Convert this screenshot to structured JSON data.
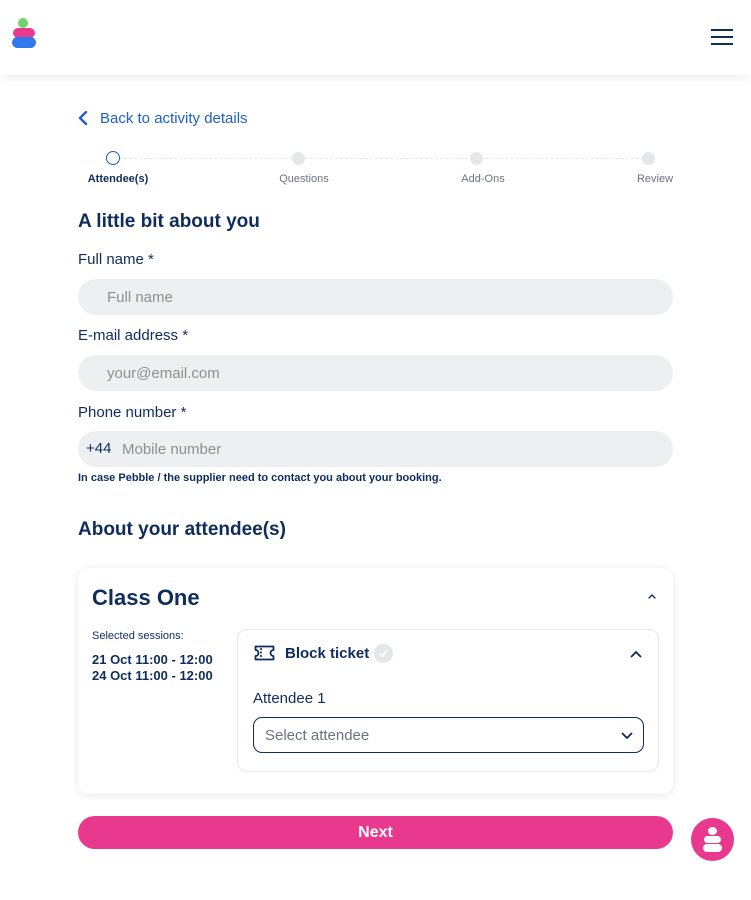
{
  "header": {
    "logo_icon": "pebble-logo",
    "menu_icon": "hamburger-menu-icon",
    "colors": {
      "logo_green": "#6ed36b",
      "logo_pink": "#ea3a8f",
      "logo_blue": "#2f78ef"
    }
  },
  "back_link": {
    "label": "Back to activity details",
    "icon": "chevron-left-icon"
  },
  "stepper": {
    "steps": [
      {
        "label": "Attendee(s)",
        "active": true
      },
      {
        "label": "Questions",
        "active": false
      },
      {
        "label": "Add-Ons",
        "active": false
      },
      {
        "label": "Review",
        "active": false
      }
    ]
  },
  "about_you": {
    "heading": "A little bit about you",
    "full_name": {
      "label": "Full name *",
      "placeholder": "Full name",
      "value": ""
    },
    "email": {
      "label": "E-mail address *",
      "placeholder": "your@email.com",
      "value": ""
    },
    "phone": {
      "label": "Phone number *",
      "country_code": "+44",
      "placeholder": "Mobile number",
      "value": ""
    },
    "hint": "In case Pebble / the supplier need to contact you about your booking."
  },
  "attendees": {
    "heading": "About your attendee(s)",
    "class": {
      "title": "Class One",
      "sessions_label": "Selected sessions:",
      "sessions": [
        "21 Oct 11:00 - 12:00",
        "24 Oct 11:00 - 12:00"
      ],
      "ticket": {
        "name": "Block ticket",
        "icon": "ticket-icon",
        "attendee_label": "Attendee 1",
        "select_placeholder": "Select attendee"
      }
    }
  },
  "next_button": {
    "label": "Next"
  },
  "accent_color": "#e8398e",
  "primary_color": "#0e2c5c",
  "link_color": "#1f5fc8"
}
